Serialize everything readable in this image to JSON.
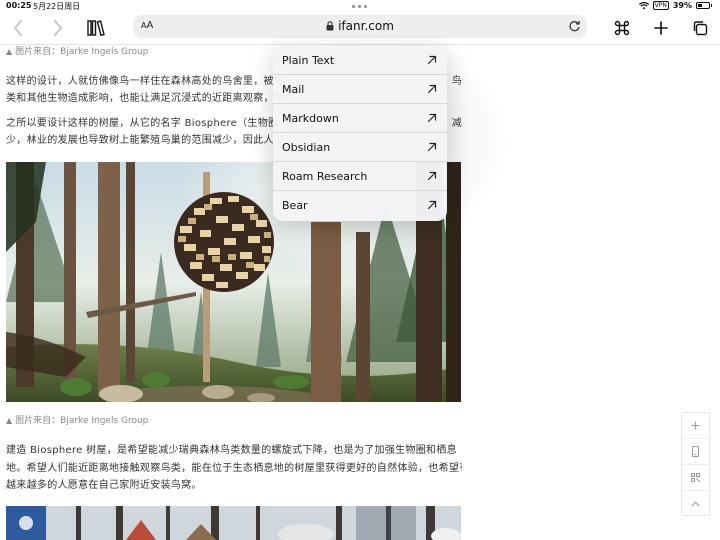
{
  "status": {
    "time": "00:25",
    "date": "5月22日周日",
    "vpn": "VPN",
    "battery_text": "39%",
    "battery_level": 0.39
  },
  "toolbar": {
    "aa_label_big": "A",
    "aa_label_small": "A",
    "url": "ifanr.com"
  },
  "article": {
    "caption_1": "图片来自：Bjarke Ingels Group",
    "para_1_line_1": "这样的设计，人就仿佛像鸟一样住在森林高处的鸟舍里，被鸟",
    "para_1_line_1_tail": "鸟",
    "para_1_line_2": "类和其他生物造成影响，也能让满足沉浸式的近距离观察，致",
    "para_2_line_1": "之所以要设计这样的树屋，从它的名字 Biosphere（生物圈",
    "para_2_line_1_tail": "减",
    "para_2_line_2": "少，林业的发展也导致树上能繁殖鸟巢的范围减少，因此人工",
    "caption_2": "图片来自：Bjarke Ingels Group",
    "para_3_line_1": "建造 Biosphere 树屋，是希望能减少瑞典森林鸟类数量的螺旋式下降，也是为了加强生物圈和栖息",
    "para_3_line_2": "地。希望人们能近距离地接触观察鸟类，能在位于生态栖息地的树屋里获得更好的自然体验，也希望有",
    "para_3_line_3": "越来越多的人愿意在自己家附近安装鸟窝。"
  },
  "share_menu": {
    "items": [
      {
        "label": "Plain Text"
      },
      {
        "label": "Mail"
      },
      {
        "label": "Markdown"
      },
      {
        "label": "Obsidian"
      },
      {
        "label": "Roam Research"
      },
      {
        "label": "Bear"
      }
    ]
  },
  "colors": {
    "accent": "#111111",
    "caption": "#8a8a8a",
    "menu_bg": "#f4f4f6"
  }
}
